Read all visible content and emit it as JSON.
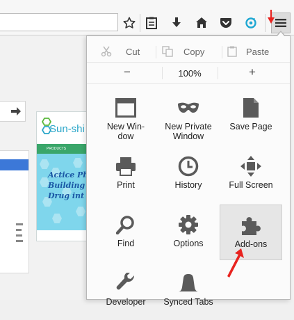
{
  "toolbar": {
    "icons": [
      "star-icon",
      "reading-list-icon",
      "download-icon",
      "home-icon",
      "pocket-icon",
      "sync-icon",
      "menu-icon"
    ]
  },
  "background_page": {
    "tile_logo_text": "Sun-shi",
    "tile_nav_text": "PRODUCTS",
    "banner_lines": [
      "Actice Ph",
      "Building",
      "Drug int"
    ]
  },
  "menu": {
    "edit": {
      "cut": "Cut",
      "copy": "Copy",
      "paste": "Paste"
    },
    "zoom": {
      "minus": "−",
      "value": "100%",
      "plus": "+"
    },
    "items": [
      {
        "label": "New Win-\ndow",
        "icon": "new-window-icon"
      },
      {
        "label": "New Private\nWindow",
        "icon": "private-mask-icon"
      },
      {
        "label": "Save Page",
        "icon": "save-page-icon"
      },
      {
        "label": "Print",
        "icon": "print-icon"
      },
      {
        "label": "History",
        "icon": "history-clock-icon"
      },
      {
        "label": "Full Screen",
        "icon": "fullscreen-icon"
      },
      {
        "label": "Find",
        "icon": "find-magnifier-icon"
      },
      {
        "label": "Options",
        "icon": "options-gear-icon"
      },
      {
        "label": "Add-ons",
        "icon": "addons-puzzle-icon"
      },
      {
        "label": "Developer",
        "icon": "developer-wrench-icon"
      },
      {
        "label": "Synced Tabs",
        "icon": "synced-tabs-icon"
      }
    ]
  },
  "colors": {
    "annotation_red": "#e8231f",
    "icon_gray": "#5a5a5a",
    "banner": "#7fd6ec"
  }
}
